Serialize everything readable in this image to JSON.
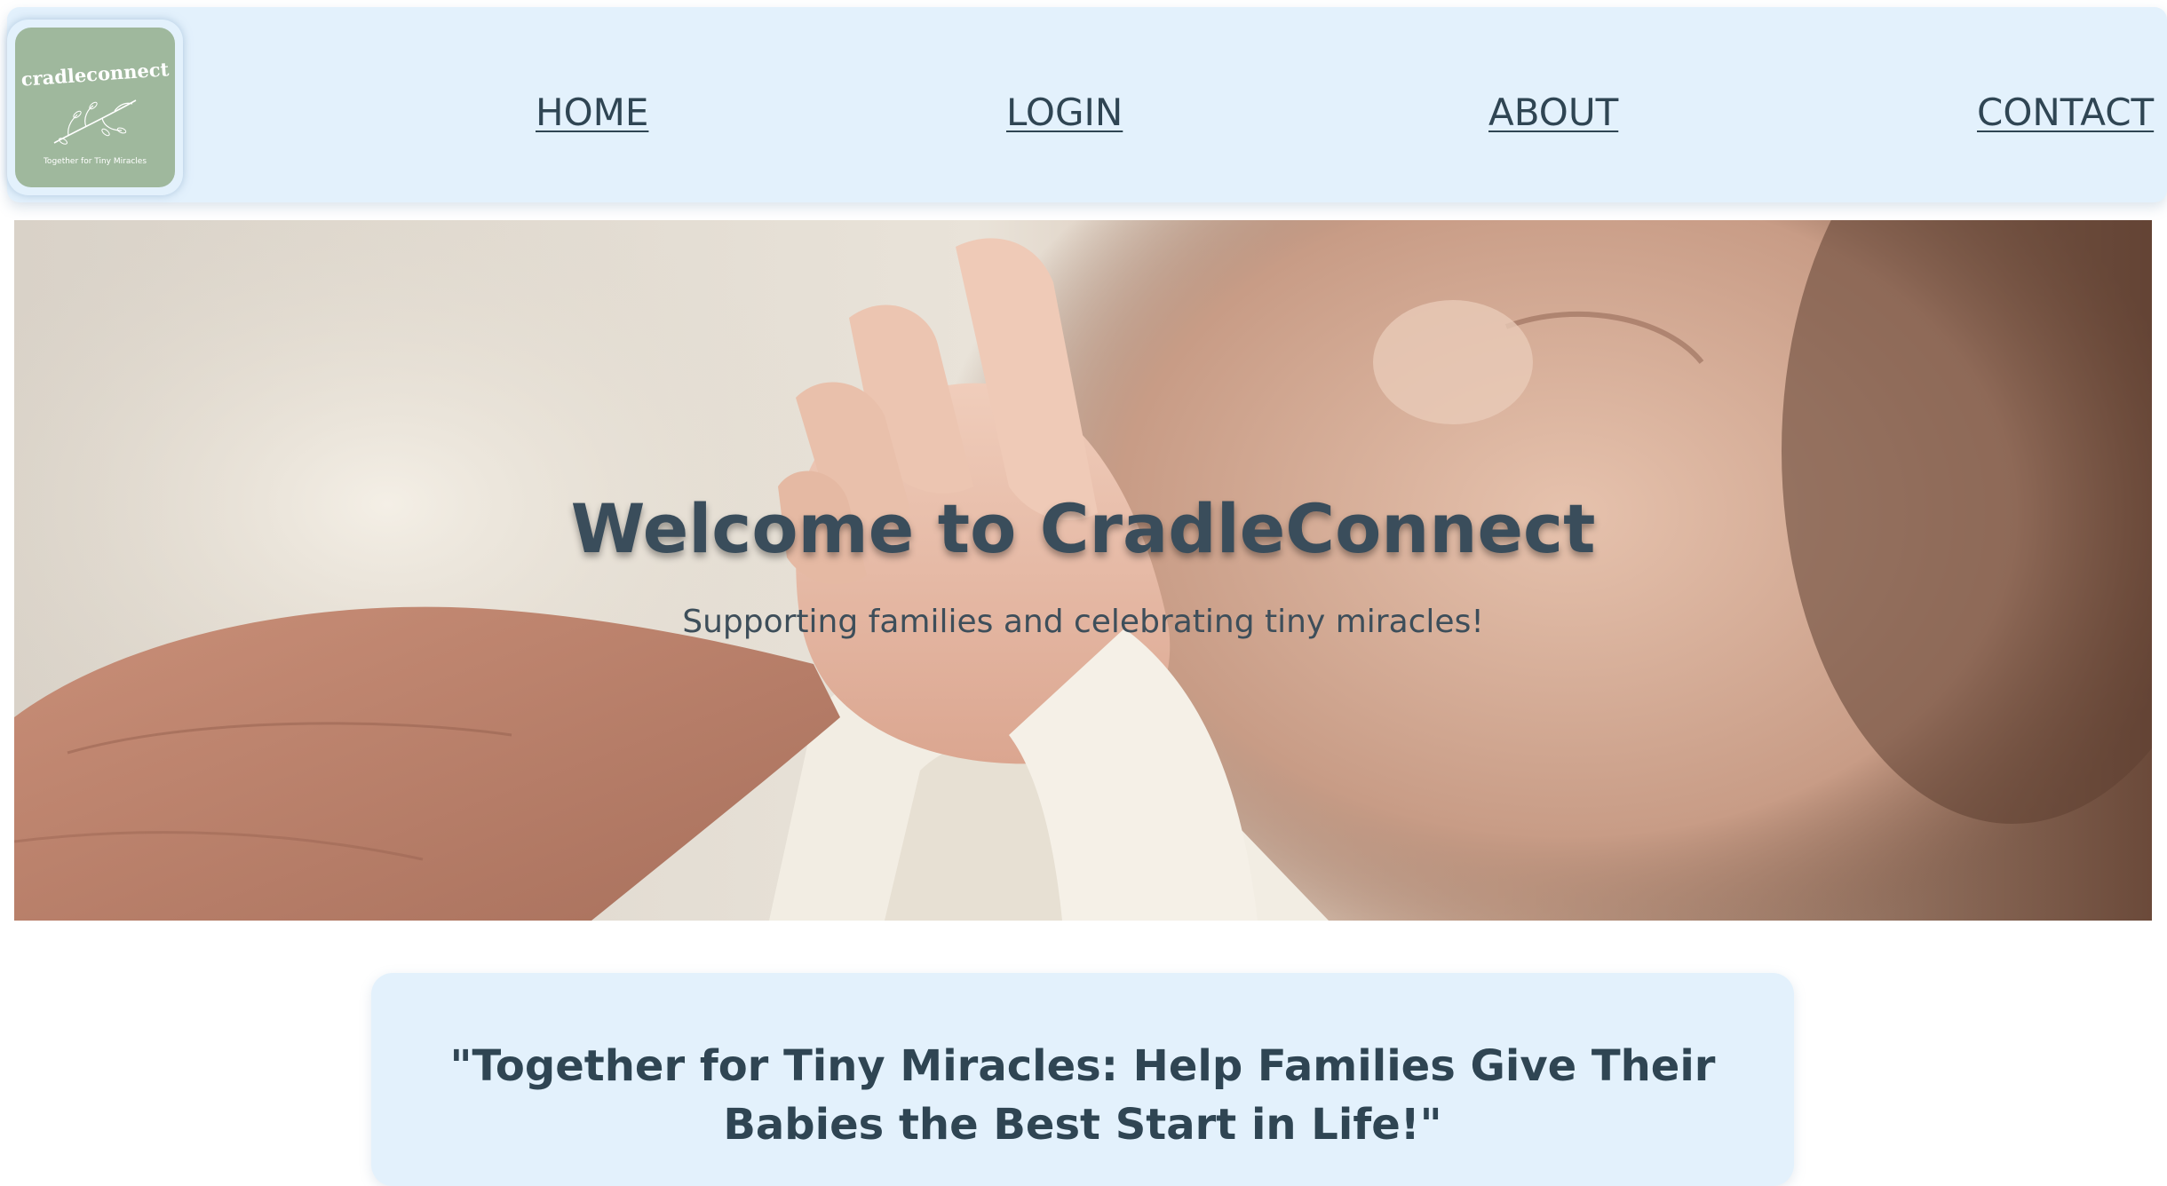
{
  "header": {
    "logo": {
      "wordmark": "cradleconnect",
      "tagline": "Together for Tiny Miracles",
      "background_color": "#9fb89d"
    },
    "nav": [
      {
        "label": "HOME"
      },
      {
        "label": "LOGIN"
      },
      {
        "label": "ABOUT"
      },
      {
        "label": "CONTACT"
      }
    ],
    "background_color": "#e3f1fc"
  },
  "hero": {
    "image": "newborn-hand-holding-finger-photo",
    "title": "Welcome to CradleConnect",
    "subtitle": "Supporting families and celebrating tiny miracles!"
  },
  "quote_card": {
    "text": "\"Together for Tiny Miracles: Help Families Give Their Babies the Best Start in Life!\""
  },
  "colors": {
    "text": "#2f4553",
    "accent_light_blue": "#e3f1fc"
  }
}
